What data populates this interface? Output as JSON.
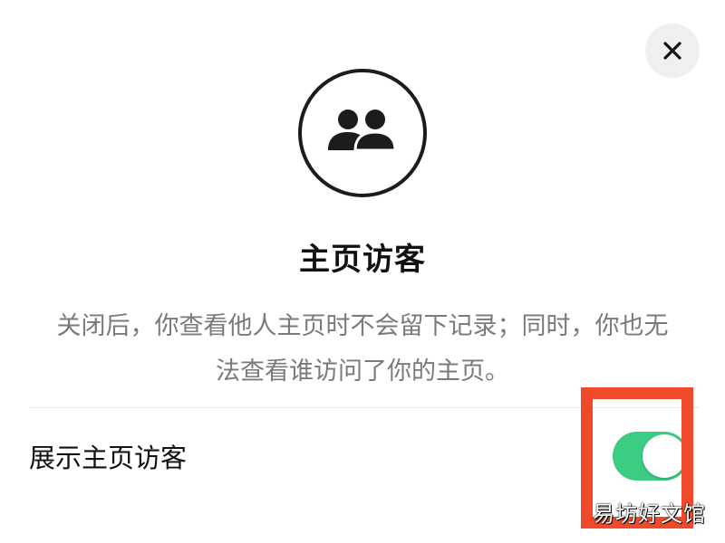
{
  "dialog": {
    "close_icon": "close-icon",
    "hero_icon": "users-icon",
    "title": "主页访客",
    "description_lines": [
      "关闭后，你查看他人主页时不会留下记录；同时，你也无",
      "法查看谁访问了你的主页。"
    ]
  },
  "setting": {
    "label": "展示主页访客",
    "toggle_on": true,
    "toggle_color": "#3dcc84"
  },
  "annotation": {
    "highlight_color": "#f04a2a"
  },
  "watermark": {
    "text": "易坊好文馆"
  }
}
